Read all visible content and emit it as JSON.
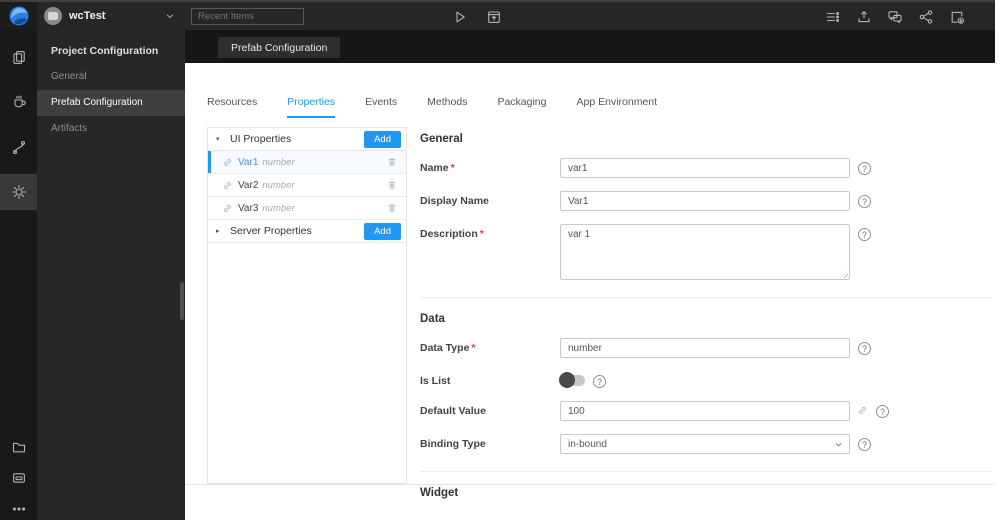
{
  "colors": {
    "accent": "#2196f3",
    "danger": "#e53935"
  },
  "header": {
    "project_name": "wcTest",
    "recent_items_placeholder": "Recent Items",
    "toolbar_icons": [
      "run",
      "deploy"
    ],
    "right_icons": [
      "preferences",
      "publish",
      "feedback",
      "share",
      "export"
    ]
  },
  "rail": {
    "top_icons": [
      {
        "name": "pages",
        "active": false
      },
      {
        "name": "java-services",
        "active": false
      },
      {
        "name": "apis",
        "active": false
      },
      {
        "name": "settings",
        "active": true
      }
    ],
    "bottom_icons": [
      {
        "name": "file-explorer",
        "active": false
      },
      {
        "name": "database",
        "active": false
      },
      {
        "name": "more",
        "active": false
      }
    ]
  },
  "sidebar": {
    "title": "Project Configuration",
    "items": [
      {
        "label": "General",
        "active": false
      },
      {
        "label": "Prefab Configuration",
        "active": true
      },
      {
        "label": "Artifacts",
        "active": false
      }
    ]
  },
  "workspace": {
    "open_tab": "Prefab Configuration"
  },
  "tabs": {
    "active": "Properties",
    "items": [
      "Resources",
      "Properties",
      "Events",
      "Methods",
      "Packaging",
      "App Environment"
    ]
  },
  "properties_panel": {
    "groups": [
      {
        "label": "UI Properties",
        "expanded": true,
        "add_label": "Add",
        "items": [
          {
            "name": "Var1",
            "type": "number",
            "selected": true
          },
          {
            "name": "Var2",
            "type": "number",
            "selected": false
          },
          {
            "name": "Var3",
            "type": "number",
            "selected": false
          }
        ]
      },
      {
        "label": "Server Properties",
        "expanded": false,
        "add_label": "Add",
        "items": []
      }
    ]
  },
  "form": {
    "sections": [
      {
        "title": "General",
        "fields": [
          {
            "label": "Name",
            "required": true,
            "control": "input",
            "value": "var1",
            "help": true
          },
          {
            "label": "Display Name",
            "required": false,
            "control": "input",
            "value": "Var1",
            "help": true
          },
          {
            "label": "Description",
            "required": true,
            "control": "textarea",
            "value": "var 1",
            "help": true
          }
        ]
      },
      {
        "title": "Data",
        "fields": [
          {
            "label": "Data Type",
            "required": true,
            "control": "input",
            "value": "number",
            "help": true
          },
          {
            "label": "Is List",
            "required": false,
            "control": "toggle",
            "value": "off",
            "help": true
          },
          {
            "label": "Default Value",
            "required": false,
            "control": "input",
            "value": "100",
            "bindable": true,
            "help": true
          },
          {
            "label": "Binding Type",
            "required": false,
            "control": "select",
            "value": "in-bound",
            "help": true
          }
        ]
      },
      {
        "title": "Widget",
        "fields": []
      }
    ]
  }
}
